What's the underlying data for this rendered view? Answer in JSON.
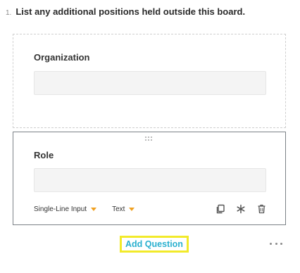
{
  "question": {
    "number": "1.",
    "text": "List any additional positions held outside this board."
  },
  "fields": [
    {
      "label": "Organization",
      "value": ""
    },
    {
      "label": "Role",
      "value": "",
      "input_type": "Single-Line Input",
      "data_type": "Text"
    }
  ],
  "actions": {
    "add_question": "Add Question"
  },
  "icons": {
    "drag": "drag-handle-icon",
    "copy": "copy-icon",
    "required": "asterisk-icon",
    "delete": "trash-icon",
    "more": "more-icon"
  },
  "colors": {
    "accent": "#2ab0cf",
    "caret": "#f0a020",
    "highlight": "#f2ea2a"
  }
}
